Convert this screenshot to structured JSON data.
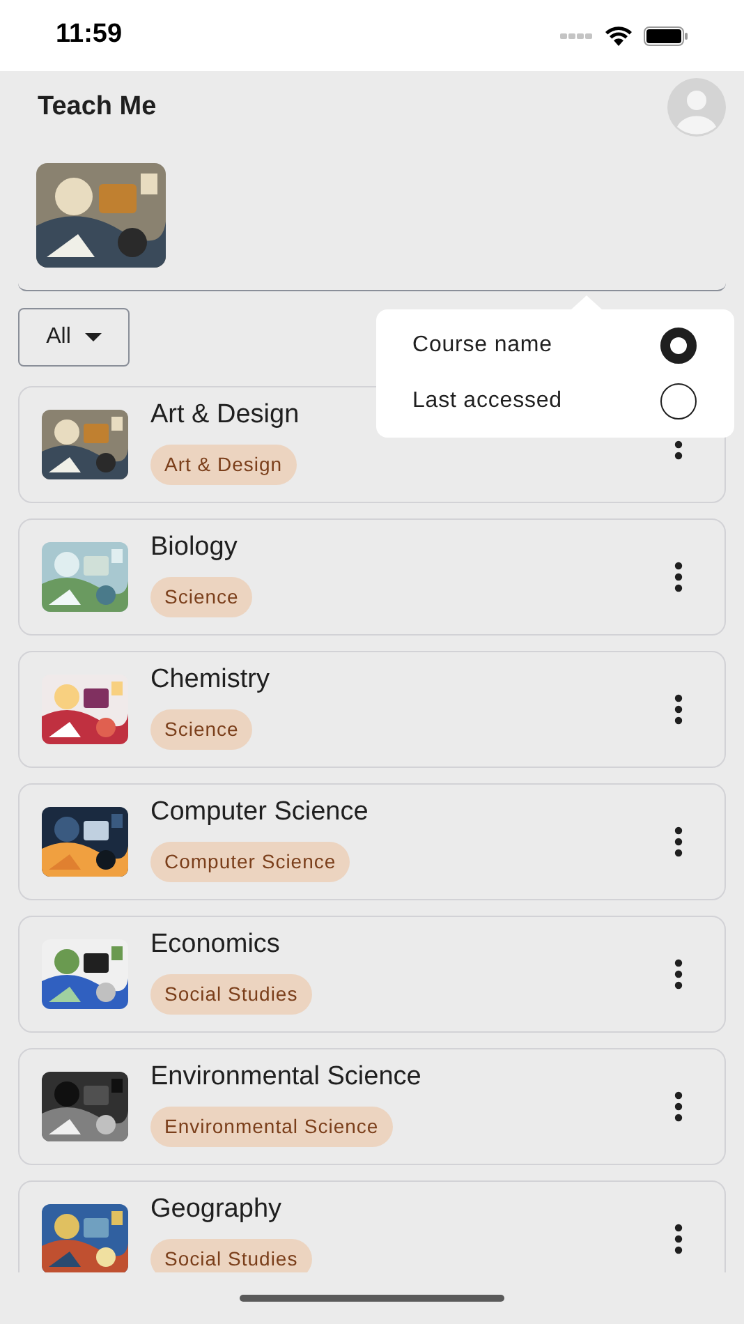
{
  "status_bar": {
    "time": "11:59"
  },
  "header": {
    "title": "Teach Me"
  },
  "filter": {
    "value": "All"
  },
  "sort_menu": {
    "options": [
      {
        "label": "Course name",
        "selected": true
      },
      {
        "label": "Last accessed",
        "selected": false
      }
    ]
  },
  "courses": [
    {
      "title": "Art & Design",
      "tag": "Art & Design"
    },
    {
      "title": "Biology",
      "tag": "Science"
    },
    {
      "title": "Chemistry",
      "tag": "Science"
    },
    {
      "title": "Computer Science",
      "tag": "Computer Science"
    },
    {
      "title": "Economics",
      "tag": "Social Studies"
    },
    {
      "title": "Environmental Science",
      "tag": "Environmental Science"
    },
    {
      "title": "Geography",
      "tag": "Social Studies"
    }
  ]
}
